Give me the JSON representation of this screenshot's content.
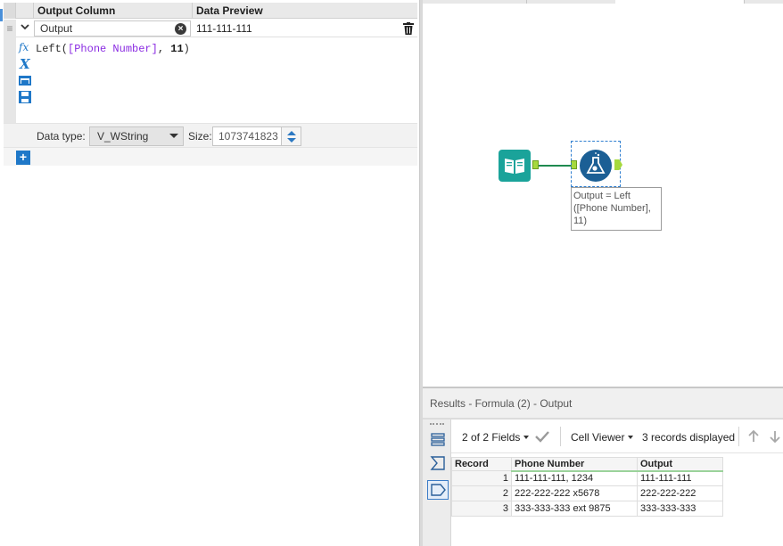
{
  "formula_panel": {
    "headers": {
      "output_column": "Output Column",
      "data_preview": "Data Preview"
    },
    "row": {
      "output_value": "Output",
      "preview_value": "111-111-111",
      "expression": "Left([Phone Number], 11)"
    },
    "data_type_label": "Data type:",
    "data_type_value": "V_WString",
    "size_label": "Size:",
    "size_value": "1073741823",
    "add_label": "+"
  },
  "canvas": {
    "annotation": "Output = Left ([Phone Number], 11)",
    "colors": {
      "input_tool": "#1aa39a",
      "formula_tool": "#1b5f95",
      "anchor": "#a6d93d",
      "connection": "#1f8a50"
    }
  },
  "results": {
    "title": "Results - Formula (2) - Output",
    "fields_selector": "2 of 2 Fields",
    "viewer": "Cell Viewer",
    "records_displayed": "3 records displayed",
    "table": {
      "columns": [
        "Record",
        "Phone Number",
        "Output"
      ],
      "rows": [
        {
          "record": "1",
          "phone": "111-111-111, 1234",
          "output": "111-111-111"
        },
        {
          "record": "2",
          "phone": "222-222-222 x5678",
          "output": "222-222-222"
        },
        {
          "record": "3",
          "phone": "333-333-333 ext 9875",
          "output": "333-333-333"
        }
      ]
    }
  }
}
